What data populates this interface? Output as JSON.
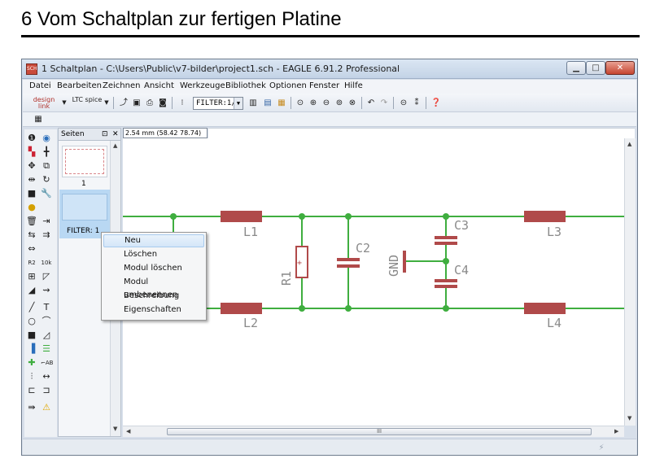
{
  "page_heading": "6  Vom Schaltplan zur fertigen Platine",
  "window": {
    "title": "1 Schaltplan - C:\\Users\\Public\\v7-bilder\\project1.sch - EAGLE 6.91.2 Professional",
    "icon_text": "SCH",
    "controls": {
      "minimize": "▁",
      "maximize": "□",
      "close": "✕"
    }
  },
  "menu": [
    "Datei",
    "Bearbeiten",
    "Zeichnen",
    "Ansicht",
    "Werkzeuge",
    "Bibliothek",
    "Optionen",
    "Fenster",
    "Hilfe"
  ],
  "toolbar": {
    "designlink": "design link",
    "ltcspice": "LTC spice",
    "filter": "FILTER:1/1"
  },
  "pages_panel": {
    "title": "Seiten",
    "pin": "⊡",
    "close": "✕",
    "page1_label": "1",
    "page2_label": "FILTER: 1"
  },
  "coords": "2.54 mm (58.42 78.74)",
  "hscroll_grip": "III",
  "context_menu": [
    "Neu",
    "Löschen",
    "Modul löschen",
    "Modul umbenennen",
    "Beschreibung",
    "Eigenschaften"
  ],
  "schematic": {
    "parts": [
      "L1",
      "L2",
      "L3",
      "L4",
      "C2",
      "C3",
      "C4",
      "R1",
      "GND"
    ],
    "wire_color": "#3fae3f",
    "part_color": "#b04a4a",
    "label_color": "#8a8a8a"
  }
}
